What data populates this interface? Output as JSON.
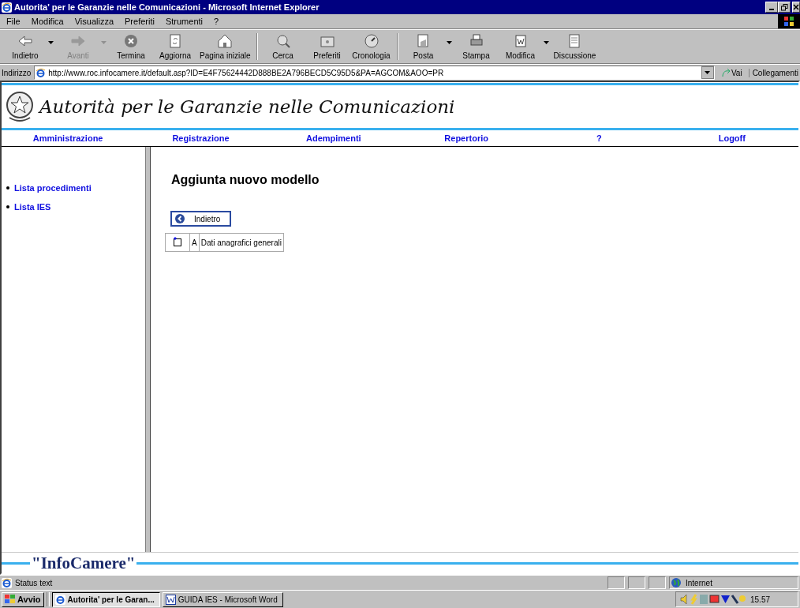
{
  "window": {
    "title": "Autorita' per le Garanzie nelle Comunicazioni - Microsoft Internet Explorer"
  },
  "menu": [
    "File",
    "Modifica",
    "Visualizza",
    "Preferiti",
    "Strumenti",
    "?"
  ],
  "toolbar": [
    {
      "label": "Indietro",
      "kind": "back",
      "disabled": false,
      "dropdown": true
    },
    {
      "label": "Avanti",
      "kind": "forward",
      "disabled": true,
      "dropdown": true
    },
    {
      "label": "Termina",
      "kind": "stop",
      "disabled": false,
      "dropdown": false
    },
    {
      "label": "Aggiorna",
      "kind": "refresh",
      "disabled": false,
      "dropdown": false
    },
    {
      "label": "Pagina iniziale",
      "kind": "home",
      "disabled": false,
      "dropdown": false
    },
    {
      "label": "Cerca",
      "kind": "search",
      "disabled": false,
      "dropdown": false
    },
    {
      "label": "Preferiti",
      "kind": "folder",
      "disabled": false,
      "dropdown": false
    },
    {
      "label": "Cronologia",
      "kind": "history",
      "disabled": false,
      "dropdown": false
    },
    {
      "label": "Posta",
      "kind": "mail",
      "disabled": false,
      "dropdown": true
    },
    {
      "label": "Stampa",
      "kind": "print",
      "disabled": false,
      "dropdown": false
    },
    {
      "label": "Modifica",
      "kind": "edit",
      "disabled": false,
      "dropdown": true
    },
    {
      "label": "Discussione",
      "kind": "doc",
      "disabled": false,
      "dropdown": false
    }
  ],
  "address": {
    "label": "Indirizzo",
    "value": "http://www.roc.infocamere.it/default.asp?ID=E4F75624442D888BE2A796BECD5C95D5&PA=AGCOM&AOO=PR",
    "go": "Vai",
    "links": "Collegamenti"
  },
  "page": {
    "header_title": "Autorità per le Garanzie nelle Comunicazioni",
    "nav": [
      "Amministrazione",
      "Registrazione",
      "Adempimenti",
      "Repertorio",
      "?",
      "Logoff"
    ],
    "sidebar": [
      "Lista procedimenti",
      "Lista IES"
    ],
    "heading": "Aggiunta nuovo modello",
    "back_button": "Indietro",
    "models": [
      {
        "code": "A",
        "name": "Dati anagrafici generali"
      }
    ],
    "footer_logo": "\"InfoCamere\""
  },
  "status_bar": {
    "text": "Status text",
    "zone": "Internet"
  },
  "taskbar": {
    "start": "Avvio",
    "tasks": [
      {
        "label": "Autorita' per le Garan...",
        "kind": "ie",
        "selected": true
      },
      {
        "label": "GUIDA IES - Microsoft Word",
        "kind": "word",
        "selected": false
      }
    ],
    "clock": "15.57"
  }
}
